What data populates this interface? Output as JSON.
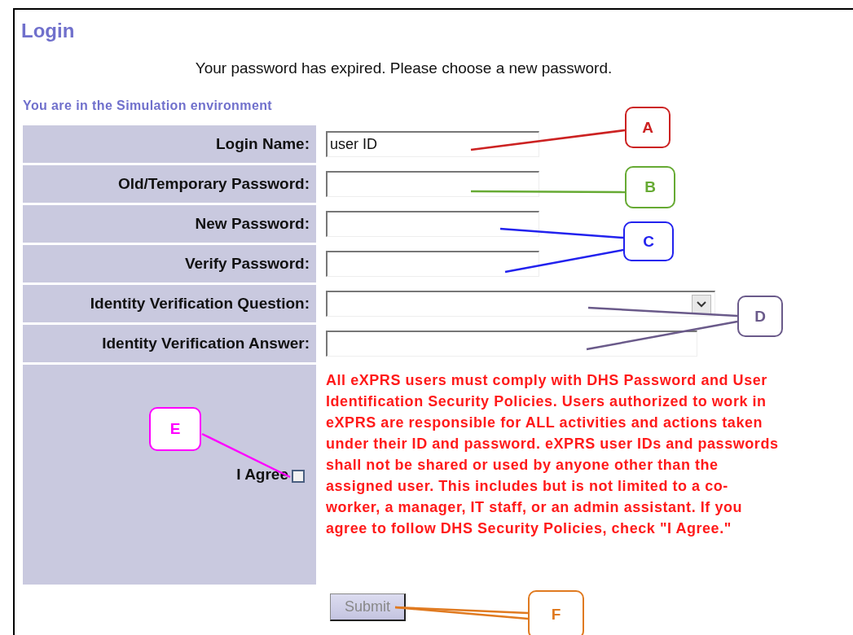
{
  "page": {
    "title": "Login",
    "message": "Your password has expired. Please choose a new password.",
    "environment": "You are in the Simulation environment"
  },
  "form": {
    "rows": [
      {
        "kind": "text",
        "label": "Login Name:",
        "value": "user ID"
      },
      {
        "kind": "password",
        "label": "Old/Temporary Password:"
      },
      {
        "kind": "password",
        "label": "New Password:"
      },
      {
        "kind": "password",
        "label": "Verify Password:"
      },
      {
        "kind": "select",
        "label": "Identity Verification Question:"
      },
      {
        "kind": "wide",
        "label": "Identity Verification Answer:"
      }
    ],
    "agreement": {
      "label": "I Agree",
      "checked": false,
      "notice": "All eXPRS users must comply with DHS Password and User Identification Security Policies. Users authorized to work in eXPRS are responsible for ALL activities and actions taken under their ID and password. eXPRS user IDs and passwords shall not be shared or used by anyone other than the assigned user. This includes but is not limited to a co-worker, a manager, IT staff, or an admin assistant. If you agree to follow DHS Security Policies, check \"I Agree.\""
    },
    "submit": {
      "label": "Submit",
      "disabled": true
    }
  },
  "callouts": [
    {
      "label": "A",
      "color": "#cc2222"
    },
    {
      "label": "B",
      "color": "#66aa33"
    },
    {
      "label": "C",
      "color": "#2222ee"
    },
    {
      "label": "D",
      "color": "#6a5a8a"
    },
    {
      "label": "E",
      "color": "#ff00ff"
    },
    {
      "label": "F",
      "color": "#e07a20"
    }
  ]
}
